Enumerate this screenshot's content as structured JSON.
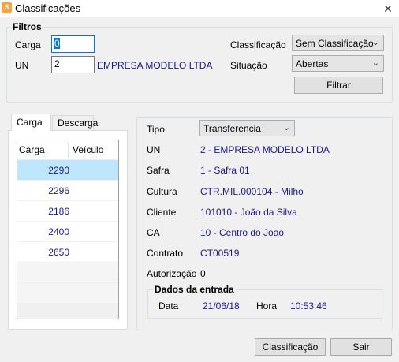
{
  "window": {
    "title": "Classificações",
    "app_icon": "app-logo-icon",
    "close_label": "✕"
  },
  "filtros": {
    "title": "Filtros",
    "carga_label": "Carga",
    "carga_value": "0",
    "un_label": "UN",
    "un_value": "2",
    "un_name": "EMPRESA MODELO LTDA",
    "classificacao_label": "Classificação",
    "classificacao_value": "Sem Classificação",
    "situacao_label": "Situação",
    "situacao_value": "Abertas",
    "filtrar_label": "Filtrar"
  },
  "tabs": [
    {
      "label": "Carga"
    },
    {
      "label": "Descarga"
    }
  ],
  "grid": {
    "columns": [
      "Carga",
      "Veículo"
    ],
    "rows": [
      {
        "carga": "2290",
        "veiculo": ""
      },
      {
        "carga": "2296",
        "veiculo": ""
      },
      {
        "carga": "2186",
        "veiculo": ""
      },
      {
        "carga": "2400",
        "veiculo": ""
      },
      {
        "carga": "2650",
        "veiculo": ""
      }
    ]
  },
  "details": {
    "tipo_label": "Tipo",
    "tipo_value": "Transferencia",
    "un_label": "UN",
    "un_value": "2 - EMPRESA MODELO LTDA",
    "safra_label": "Safra",
    "safra_value": "1 - Safra 01",
    "cultura_label": "Cultura",
    "cultura_value": "CTR.MIL.000104 - Milho",
    "cliente_label": "Cliente",
    "cliente_value": "101010 - João da Silva",
    "ca_label": "CA",
    "ca_value": "10 - Centro do Joao",
    "contrato_label": "Contrato",
    "contrato_value": "CT00519",
    "autorizacao_label": "Autorização",
    "autorizacao_value": "0",
    "entrada_title": "Dados da entrada",
    "data_label": "Data",
    "data_value": "21/06/18",
    "hora_label": "Hora",
    "hora_value": "10:53:46"
  },
  "footer": {
    "classificacao_label": "Classificação",
    "sair_label": "Sair"
  },
  "colors": {
    "accent": "#0078d7",
    "value_text": "#1a1a8c",
    "selected_row": "#bee6fd"
  }
}
